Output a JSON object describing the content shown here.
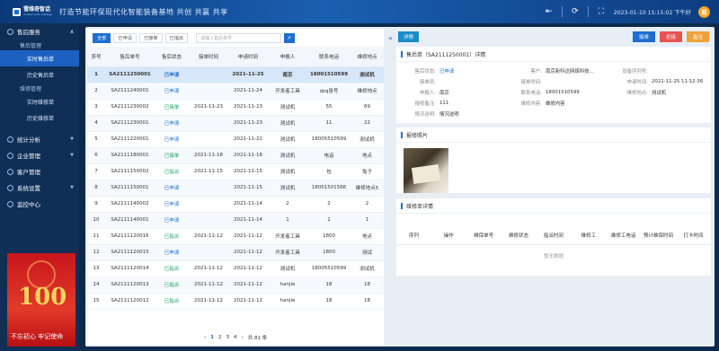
{
  "header": {
    "logo_name": "雪维奇智话",
    "logo_sub": "Xuewei Auto Intellige",
    "slogan": "打造节能环保现代化智能装备基地    共创 共赢 共享",
    "datetime": "2023-01-10 15:15:02 下午好",
    "avatar": "超"
  },
  "sidebar": {
    "groups": [
      {
        "label": "售后服务",
        "subs": [
          {
            "label": "售后管理",
            "leaves": [
              "实时售后单",
              "历史售后单"
            ]
          },
          {
            "label": "维修管理",
            "leaves": [
              "实时维修单",
              "历史维修单"
            ]
          }
        ]
      }
    ],
    "others": [
      "统计分析",
      "企业管理",
      "客户管理",
      "系统设置",
      "监控中心"
    ],
    "banner": {
      "big": "100",
      "text": "不忘初心 牢记使命"
    }
  },
  "filters": {
    "tabs": [
      "全部",
      "已申请",
      "已接单",
      "已指派"
    ],
    "search_placeholder": "请输入售后单号",
    "search_icon": "search-icon"
  },
  "table": {
    "headers": [
      "序号",
      "售后单号",
      "售后状态",
      "接单时间",
      "申请时间",
      "申报人",
      "联系电话",
      "维修地点"
    ],
    "rows": [
      [
        "1",
        "SA2111250001",
        "已申请",
        "",
        "2021-11-25",
        "南京",
        "18001510599",
        "测试机"
      ],
      [
        "2",
        "SA2111240001",
        "已申请",
        "",
        "2021-11-24",
        "开发者工具",
        "dzq张号",
        "维修地点"
      ],
      [
        "3",
        "SA2111230002",
        "已接单",
        "2021-11-23",
        "2021-11-23",
        "测试机",
        "55",
        "69"
      ],
      [
        "4",
        "SA2111230001",
        "已申请",
        "",
        "2021-11-23",
        "测试机",
        "11",
        "22"
      ],
      [
        "5",
        "SA2111220001",
        "已申请",
        "",
        "2021-11-22",
        "测试机",
        "18005510599",
        "测试机"
      ],
      [
        "6",
        "SA2111180001",
        "已接单",
        "2021-11-18",
        "2021-11-18",
        "测试机",
        "电话",
        "地点"
      ],
      [
        "7",
        "SA2111150002",
        "已指派",
        "2021-11-15",
        "2021-11-15",
        "测试机",
        "包",
        "兔子"
      ],
      [
        "8",
        "SA2111150001",
        "已申请",
        "",
        "2021-11-15",
        "测试机",
        "18001501566",
        "维修地点5"
      ],
      [
        "9",
        "SA2111140002",
        "已申请",
        "",
        "2021-11-14",
        "2",
        "2",
        "2"
      ],
      [
        "10",
        "SA2111140001",
        "已申请",
        "",
        "2021-11-14",
        "1",
        "1",
        "1"
      ],
      [
        "11",
        "SA2111120016",
        "已指派",
        "2021-11-12",
        "2021-11-12",
        "开发者工具",
        "1800",
        "地点"
      ],
      [
        "12",
        "SA2111120015",
        "已申请",
        "",
        "2021-11-12",
        "开发者工具",
        "1800",
        "测试"
      ],
      [
        "13",
        "SA2111120014",
        "已指派",
        "2021-11-12",
        "2021-11-12",
        "测试机",
        "18005510599",
        "测试机"
      ],
      [
        "14",
        "SA2111120013",
        "已指派",
        "2021-11-12",
        "2021-11-12",
        "hanjie",
        "18",
        "18"
      ],
      [
        "15",
        "SA2111120012",
        "已指派",
        "2021-11-12",
        "2021-11-12",
        "hanjie",
        "18",
        "18"
      ]
    ]
  },
  "pager": {
    "prev": "‹",
    "pages": [
      "1",
      "2",
      "3",
      "4"
    ],
    "next": "›",
    "total": "共 81 条"
  },
  "detail": {
    "detail_label": "详情",
    "actions": {
      "accept": "接单",
      "reject": "拒接",
      "remark": "备注"
    },
    "title": "售后单（SA2111250001）详情",
    "fields": [
      {
        "k": "售后状态:",
        "v": "已申请"
      },
      {
        "k": "客户:",
        "v": "南京新科达网络科技..."
      },
      {
        "k": "设备序列号:",
        "v": ""
      },
      {
        "k": "接单员:",
        "v": ""
      },
      {
        "k": "接单时间:",
        "v": ""
      },
      {
        "k": "申请时间:",
        "v": "2021-11-25 11:12:36"
      },
      {
        "k": "申报人:",
        "v": "南京"
      },
      {
        "k": "联系电话:",
        "v": "18001510599"
      },
      {
        "k": "维修地点:",
        "v": "测试机"
      },
      {
        "k": "报修备注:",
        "v": "111"
      },
      {
        "k": "维修内容:",
        "v": "维修内容"
      },
      {
        "k": "",
        "v": ""
      },
      {
        "k": "情况说明:",
        "v": "情况说明"
      },
      {
        "k": "",
        "v": ""
      },
      {
        "k": "",
        "v": ""
      }
    ],
    "photo_title": "报修照片",
    "repair_title": "维修单详情",
    "repair_headers": [
      "序列",
      "操作",
      "维保单号",
      "维修状态",
      "指派时间",
      "维修工",
      "维修工电话",
      "预计维保时间",
      "打卡时间"
    ],
    "no_data": "暂无数据"
  },
  "colors": {
    "accent": "#1e6fd0",
    "accept": "#1e6fd0",
    "reject": "#e8544f",
    "remark": "#f0a13a"
  }
}
